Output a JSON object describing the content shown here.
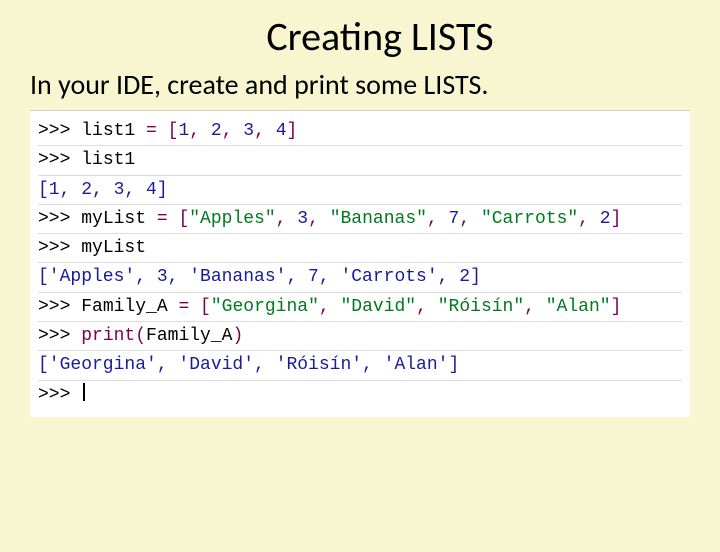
{
  "title": "Creating LISTS",
  "subtitle": "In your IDE, create and print some LISTS.",
  "prompt": ">>>",
  "lines": {
    "l1": {
      "ident": "list1",
      "eq": " = ",
      "open": "[",
      "v1": "1",
      "c": ", ",
      "v2": "2",
      "v3": "3",
      "v4": "4",
      "close": "]"
    },
    "l2": {
      "ident": "list1"
    },
    "l3": {
      "out": "[1, 2, 3, 4]"
    },
    "l4": {
      "ident": "myList",
      "eq": " = ",
      "open": "[",
      "s1": "\"Apples\"",
      "c": ", ",
      "n1": "3",
      "s2": "\"Bananas\"",
      "n2": "7",
      "s3": "\"Carrots\"",
      "n3": "2",
      "close": "]"
    },
    "l5": {
      "ident": "myList"
    },
    "l6": {
      "out": "['Apples', 3, 'Bananas', 7, 'Carrots', 2]"
    },
    "l7": {
      "ident": "Family_A",
      "eq": " = ",
      "open": "[",
      "s1": "\"Georgina\"",
      "c": ", ",
      "s2": "\"David\"",
      "s3": "\"Róisín\"",
      "s4": "\"Alan\"",
      "close": "]"
    },
    "l8": {
      "func": "print",
      "open": "(",
      "arg": "Family_A",
      "close": ")"
    },
    "l9": {
      "out": "['Georgina', 'David', 'Róisín', 'Alan']"
    }
  }
}
